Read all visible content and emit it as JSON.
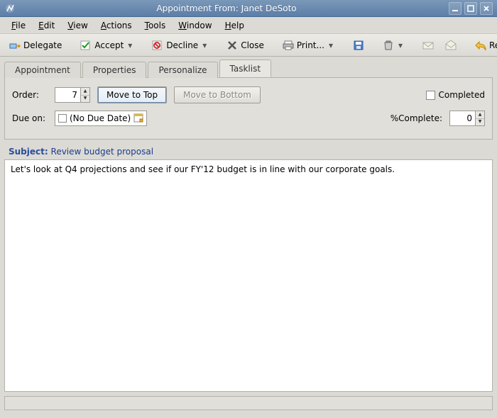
{
  "window": {
    "title": "Appointment From: Janet DeSoto"
  },
  "menu": {
    "file": "File",
    "edit": "Edit",
    "view": "View",
    "actions": "Actions",
    "tools": "Tools",
    "window": "Window",
    "help": "Help"
  },
  "toolbar": {
    "delegate": "Delegate",
    "accept": "Accept",
    "decline": "Decline",
    "close": "Close",
    "print": "Print...",
    "reply": "Reply"
  },
  "tabs": {
    "appointment": "Appointment",
    "properties": "Properties",
    "personalize": "Personalize",
    "tasklist": "Tasklist"
  },
  "tasklist": {
    "order_label": "Order:",
    "order_value": "7",
    "move_top": "Move to Top",
    "move_bottom": "Move to Bottom",
    "completed": "Completed",
    "due_label": "Due on:",
    "due_value": "(No Due Date)",
    "percent_label": "%Complete:",
    "percent_value": "0"
  },
  "subject": {
    "label": "Subject:",
    "value": "Review budget proposal"
  },
  "body": "Let's look at Q4 projections and see if our FY'12 budget is in line with our corporate goals."
}
